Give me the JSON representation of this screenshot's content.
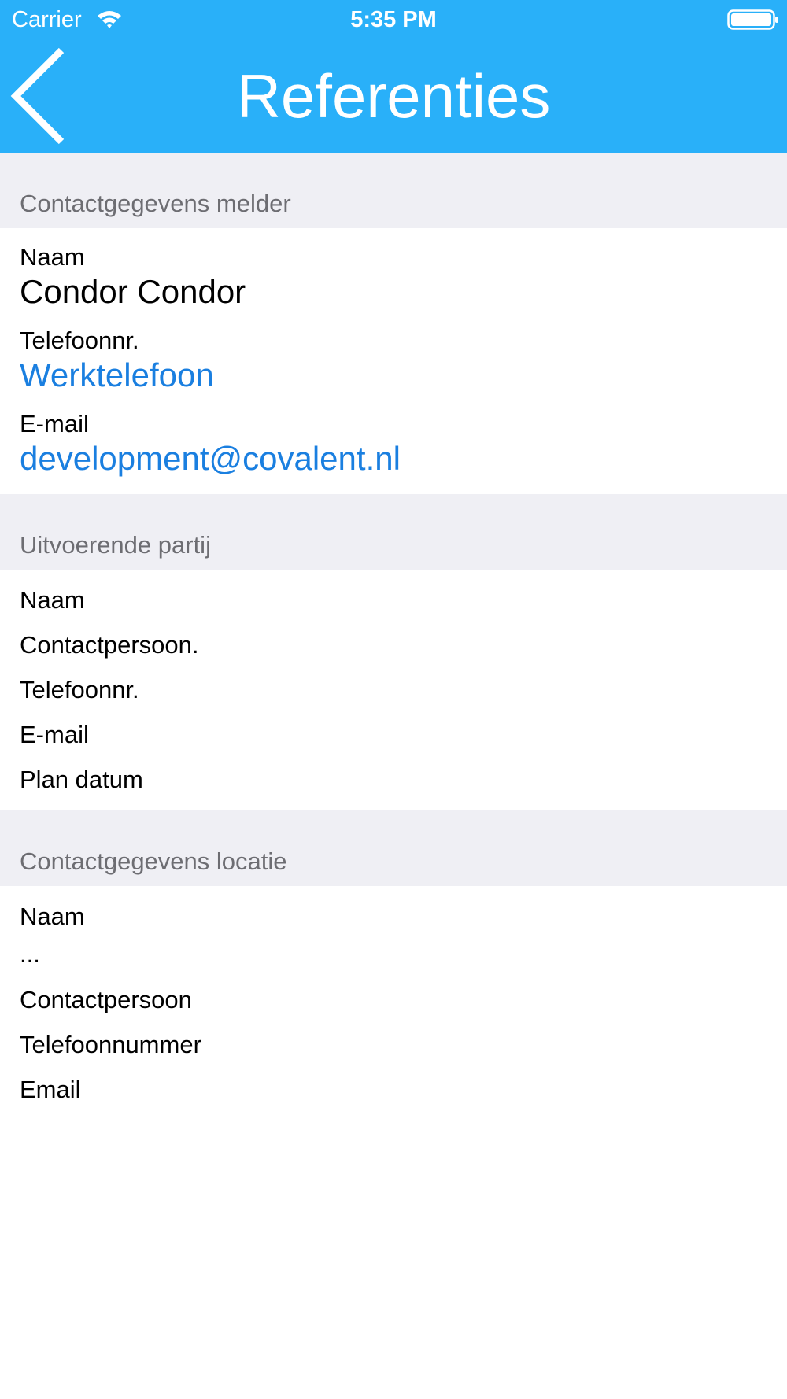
{
  "status_bar": {
    "carrier": "Carrier",
    "time": "5:35 PM",
    "wifi_icon": "wifi-icon",
    "battery_icon": "battery-full-icon"
  },
  "nav": {
    "title": "Referenties",
    "back_icon": "chevron-left-icon",
    "bar_color": "#29b0f9"
  },
  "colors": {
    "link": "#1a7fe0",
    "section_background": "#efeff4",
    "section_header_text": "#6d6d72"
  },
  "sections": [
    {
      "header": "Contactgegevens melder",
      "fields": [
        {
          "label": "Naam",
          "value": "Condor  Condor"
        },
        {
          "label": "Telefoonnr.",
          "value": "Werktelefoon"
        },
        {
          "label": "E-mail",
          "value": "development@covalent.nl"
        }
      ]
    },
    {
      "header": "Uitvoerende partij",
      "fields": [
        {
          "label": "Naam"
        },
        {
          "label": "Contactpersoon."
        },
        {
          "label": "Telefoonnr."
        },
        {
          "label": "E-mail"
        },
        {
          "label": "Plan datum"
        }
      ]
    },
    {
      "header": "Contactgegevens locatie",
      "fields": [
        {
          "label": "Naam",
          "value": "..."
        },
        {
          "label": "Contactpersoon"
        },
        {
          "label": "Telefoonnummer"
        },
        {
          "label": "Email"
        }
      ]
    }
  ]
}
